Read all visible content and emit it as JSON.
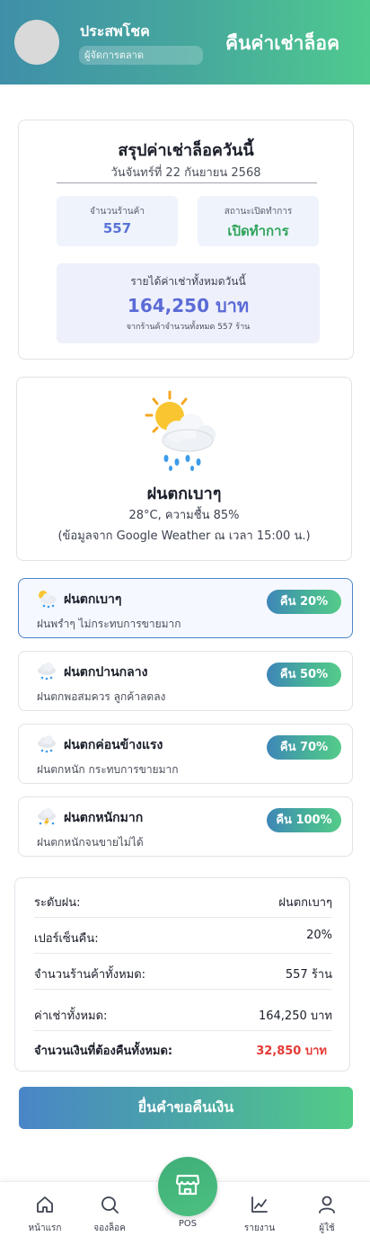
{
  "header": {
    "user_name": "ประสพโชค",
    "user_role": "ผู้จัดการตลาด",
    "title": "คืนค่าเช่าล็อค"
  },
  "summary": {
    "title": "สรุปค่าเช่าล็อควันนี้",
    "date": "วันจันทร์ที่ 22 กันยายน 2568",
    "shops_label": "จำนวนร้านค้า",
    "shops_value": "557",
    "status_label": "สถานะเปิดทำการ",
    "status_value": "เปิดทำการ",
    "income_label": "รายได้ค่าเช่าทั้งหมดวันนี้",
    "income_value": "164,250 บาท",
    "income_note": "จากร้านค้าจำนวนทั้งหมด 557 ร้าน"
  },
  "weather": {
    "icon": "sun-cloud-rain-icon",
    "title": "ฝนตกเบาๆ",
    "detail": "28°C, ความชื้น 85%",
    "source": "(ข้อมูลจาก Google Weather ณ เวลา 15:00 น.)"
  },
  "rain_options": [
    {
      "icon": "sun-behind-rain-cloud-icon",
      "title": "ฝนตกเบาๆ",
      "description": "ฝนพรำๆ ไม่กระทบการขายมาก",
      "badge": "คืน 20%",
      "selected": true
    },
    {
      "icon": "cloud-rain-icon",
      "title": "ฝนตกปานกลาง",
      "description": "ฝนตกพอสมควร ลูกค้าลดลง",
      "badge": "คืน 50%",
      "selected": false
    },
    {
      "icon": "cloud-rain-icon",
      "title": "ฝนตกค่อนข้างแรง",
      "description": "ฝนตกหนัก กระทบการขายมาก",
      "badge": "คืน 70%",
      "selected": false
    },
    {
      "icon": "cloud-lightning-rain-icon",
      "title": "ฝนตกหนักมาก",
      "description": "ฝนตกหนักจนขายไม่ได้",
      "badge": "คืน 100%",
      "selected": false
    }
  ],
  "details": [
    {
      "label": "ระดับฝน:",
      "value": "ฝนตกเบาๆ"
    },
    {
      "label": "เปอร์เซ็นคืน:",
      "value": "20%"
    },
    {
      "label": "จำนวนร้านค้าทั้งหมด:",
      "value": "557 ร้าน"
    },
    {
      "label": "ค่าเช่าทั้งหมด:",
      "value": "164,250 บาท"
    },
    {
      "label": "จำนวนเงินที่ต้องคืนทั้งหมด:",
      "value": "32,850 บาท"
    }
  ],
  "submit_label": "ยื่นคำขอคืนเงิน",
  "nav": {
    "home": "หน้าแรก",
    "booking": "จองล็อค",
    "pos": "POS",
    "reports": "รายงาน",
    "user": "ผู้ใช้"
  },
  "colors": {
    "header_start": "#3f8fa8",
    "header_end": "#4fca8e",
    "accent_blue": "#5b6bd6",
    "status_green": "#2fa45a",
    "refund_red": "#e53935"
  }
}
